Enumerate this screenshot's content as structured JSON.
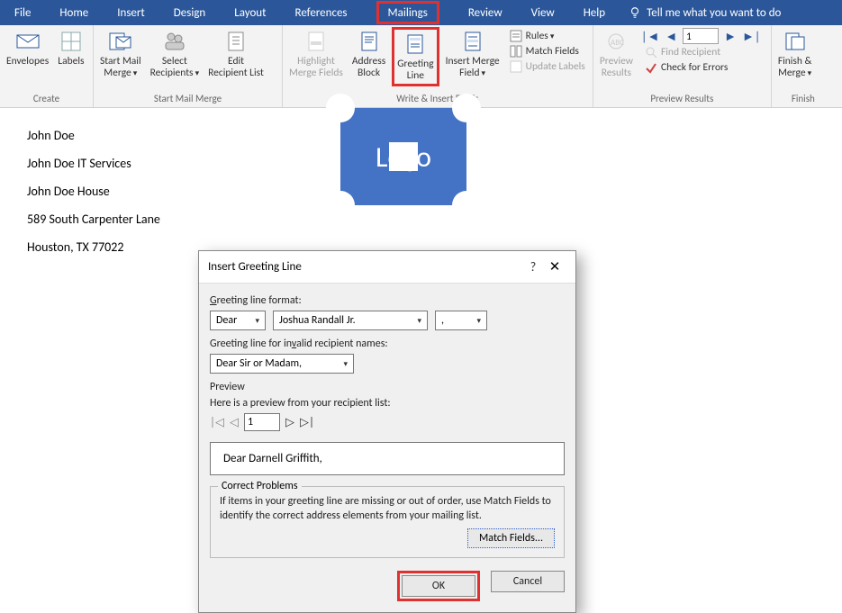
{
  "menu": {
    "items": [
      "File",
      "Home",
      "Insert",
      "Design",
      "Layout",
      "References",
      "Mailings",
      "Review",
      "View",
      "Help"
    ],
    "active": "Mailings",
    "tell_me": "Tell me what you want to do"
  },
  "ribbon": {
    "groups": {
      "create": {
        "label": "Create",
        "envelopes": "Envelopes",
        "labels": "Labels"
      },
      "start": {
        "label": "Start Mail Merge",
        "start_mail_merge": "Start Mail\nMerge",
        "select_recipients": "Select\nRecipients",
        "edit_recipient_list": "Edit\nRecipient List"
      },
      "write": {
        "label": "Write & Insert Fields",
        "highlight": "Highlight\nMerge Fields",
        "address_block": "Address\nBlock",
        "greeting_line": "Greeting\nLine",
        "insert_merge_field": "Insert Merge\nField",
        "rules": "Rules",
        "match_fields": "Match Fields",
        "update_labels": "Update Labels"
      },
      "preview": {
        "label": "Preview Results",
        "preview_results": "Preview\nResults",
        "find_recipient": "Find Recipient",
        "check_errors": "Check for Errors",
        "record": "1"
      },
      "finish": {
        "label": "Finish",
        "finish_merge": "Finish &\nMerge"
      }
    }
  },
  "document": {
    "lines": [
      "John Doe",
      "John Doe IT Services",
      "John Doe House",
      "589 South Carpenter Lane",
      "Houston, TX 77022"
    ],
    "logo_text": "Logo"
  },
  "dialog": {
    "title": "Insert Greeting Line",
    "greeting_format_label_pre": "G",
    "greeting_format_label_post": "reeting line format:",
    "salutation": "Dear",
    "name_format": "Joshua Randall Jr.",
    "punct": ",",
    "invalid_label_pre": "Greeting line for in",
    "invalid_label_mid": "v",
    "invalid_label_post": "alid recipient names:",
    "invalid_value": "Dear Sir or Madam,",
    "preview_label": "Preview",
    "preview_hint": "Here is a preview from your recipient list:",
    "preview_index": "1",
    "preview_text": "Dear Darnell Griffith,",
    "correct_title": "Correct Problems",
    "correct_text": "If items in your greeting line are missing or out of order, use Match Fields to identify the correct address elements from your mailing list.",
    "match_fields_btn": "Match Fields...",
    "ok": "OK",
    "cancel": "Cancel"
  }
}
